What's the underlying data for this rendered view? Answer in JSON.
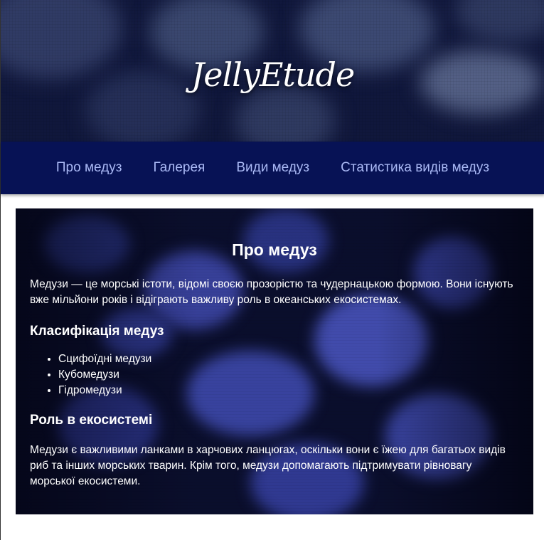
{
  "header": {
    "logo_text": "JellyEtude"
  },
  "nav": {
    "items": [
      {
        "label": "Про медуз"
      },
      {
        "label": "Галерея"
      },
      {
        "label": "Види медуз"
      },
      {
        "label": "Статистика видів медуз"
      }
    ]
  },
  "main": {
    "title": "Про медуз",
    "intro": "Медузи — це морські істоти, відомі своєю прозорістю та чудернацькою формою. Вони існують вже мільйони років і відіграють важливу роль в океанських екосистемах.",
    "classification": {
      "heading": "Класифікація медуз",
      "items": [
        "Сцифоїдні медузи",
        "Кубомедузи",
        "Гідромедузи"
      ]
    },
    "ecosystem": {
      "heading": "Роль в екосистемі",
      "text": "Медузи є важливими ланками в харчових ланцюгах, оскільки вони є їжею для багатьох видів риб та інших морських тварин. Крім того, медузи допомагають підтримувати рівновагу морської екосистеми."
    }
  },
  "colors": {
    "nav_background": "#071255",
    "nav_link": "#aab9f5",
    "panel_background": "#0b0f2e",
    "text": "#ffffff"
  }
}
